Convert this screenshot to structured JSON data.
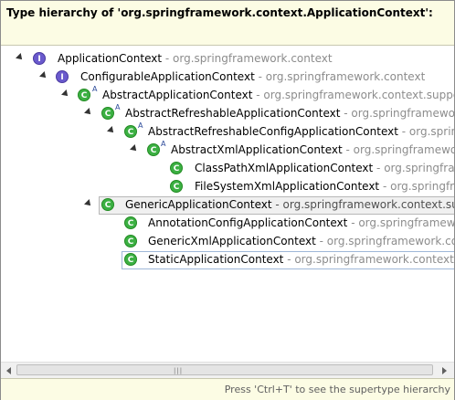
{
  "header": {
    "title": "Type hierarchy of 'org.springframework.context.ApplicationContext':",
    "filter_value": ""
  },
  "tree": [
    {
      "name": "ApplicationContext",
      "pkg": " - org.springframework.context",
      "kind": "interface"
    },
    {
      "name": "ConfigurableApplicationContext",
      "pkg": " - org.springframework.context",
      "kind": "interface"
    },
    {
      "name": "AbstractApplicationContext",
      "pkg": " - org.springframework.context.suppor",
      "kind": "class",
      "flag": "A"
    },
    {
      "name": "AbstractRefreshableApplicationContext",
      "pkg": " - org.springframewor",
      "kind": "class",
      "flag": "A"
    },
    {
      "name": "AbstractRefreshableConfigApplicationContext",
      "pkg": " - org.sprin",
      "kind": "class",
      "flag": "A"
    },
    {
      "name": "AbstractXmlApplicationContext",
      "pkg": " - org.springframewo",
      "kind": "class",
      "flag": "A"
    },
    {
      "name": "ClassPathXmlApplicationContext",
      "pkg": " - org.springfra",
      "kind": "class"
    },
    {
      "name": "FileSystemXmlApplicationContext",
      "pkg": " - org.springfra",
      "kind": "class"
    },
    {
      "name": "GenericApplicationContext",
      "pkg": " - org.springframework.context.sup",
      "kind": "class"
    },
    {
      "name": "AnnotationConfigApplicationContext",
      "pkg": " - org.springframew",
      "kind": "class"
    },
    {
      "name": "GenericXmlApplicationContext",
      "pkg": " - org.springframework.cont",
      "kind": "class"
    },
    {
      "name": "StaticApplicationContext",
      "pkg": " - org.springframework.context.su",
      "kind": "class"
    }
  ],
  "icons": {
    "interface_glyph": "I",
    "class_glyph": "C",
    "interface_color": "#6a5acd",
    "class_color": "#3cb043"
  },
  "scrollbar": {
    "grip": "|||"
  },
  "status": {
    "text": "Press 'Ctrl+T' to see the supertype hierarchy"
  }
}
